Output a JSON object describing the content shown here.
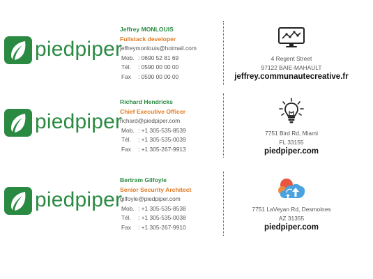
{
  "signatures": [
    {
      "brand": "piedpiper",
      "name": "Jeffrey MONLOUIS",
      "title": "Fullstack developer",
      "email": "jeffreymonlouis@hotmail.com",
      "phones": [
        {
          "label": "Mob.",
          "value": ": 0690 52 81 69"
        },
        {
          "label": "Tél.",
          "value": ": 0590 00 00 00"
        },
        {
          "label": "Fax",
          "value": ": 0590 00 00 00"
        }
      ],
      "icon": "monitor-chart-icon",
      "address_line1": "4 Regent Street",
      "address_line2": "97122 BAIE-MAHAULT",
      "website": "jeffrey.communautecreative.fr"
    },
    {
      "brand": "piedpiper",
      "name": "Richard Hendricks",
      "title": "Chief Executive Officer",
      "email": "richard@piedpiper.com",
      "phones": [
        {
          "label": "Mob.",
          "value": ": +1 305-535-8539"
        },
        {
          "label": "Tél.",
          "value": ": +1 305-535-0039"
        },
        {
          "label": "Fax",
          "value": ": +1 305-267-9913"
        }
      ],
      "icon": "lightbulb-icon",
      "address_line1": "7751 Bird Rd, Miami",
      "address_line2": "FL 33155",
      "website": "piedpiper.com"
    },
    {
      "brand": "piedpiper",
      "name": "Bertram Gilfoyle",
      "title": "Senior Security Architect",
      "email": "gilfoyle@piedpiper.com",
      "phones": [
        {
          "label": "Mob.",
          "value": ": +1 305-535-8538"
        },
        {
          "label": "Tél.",
          "value": ": +1 305-535-0038"
        },
        {
          "label": "Fax",
          "value": ": +1 305-267-9910"
        }
      ],
      "icon": "cloud-upload-icon",
      "address_line1": "7751 LaVeyan Rd, Desmoines",
      "address_line2": "AZ 31355",
      "website": "piedpiper.com"
    }
  ],
  "colors": {
    "brand_green": "#2a8a42",
    "title_orange": "#e07b25",
    "text_gray": "#555555"
  }
}
